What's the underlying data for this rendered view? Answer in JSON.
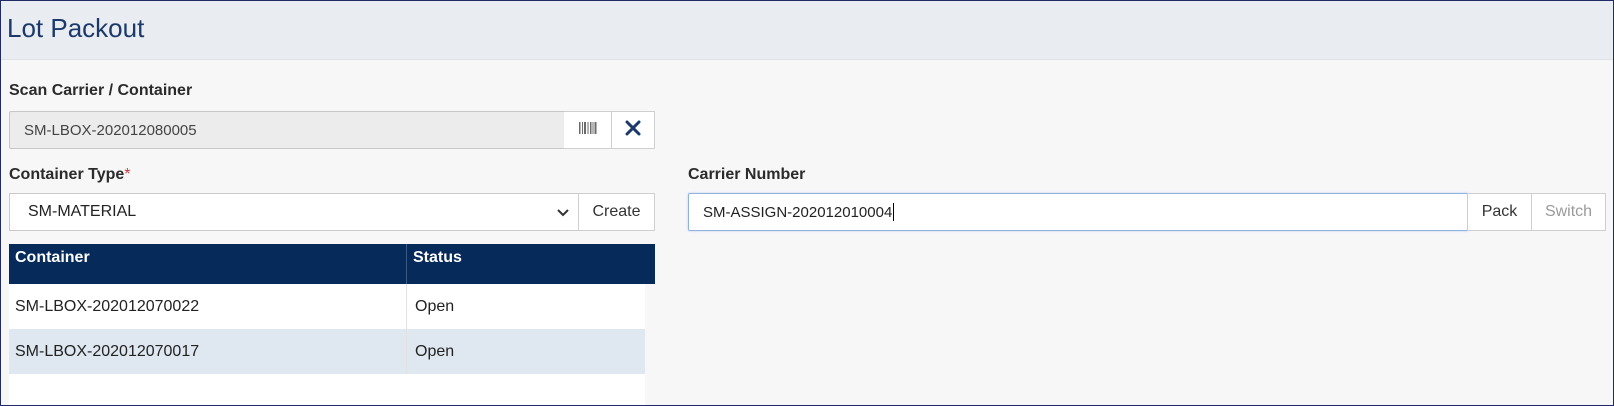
{
  "page": {
    "title": "Lot Packout"
  },
  "scan": {
    "label": "Scan Carrier / Container",
    "value": "SM-LBOX-202012080005",
    "barcode_icon": "barcode-icon",
    "clear_icon": "close-icon"
  },
  "container_type": {
    "label": "Container Type",
    "required_mark": "*",
    "selected": "SM-MATERIAL",
    "create_label": "Create"
  },
  "carrier": {
    "label": "Carrier Number",
    "value": "SM-ASSIGN-202012010004",
    "pack_label": "Pack",
    "switch_label": "Switch"
  },
  "table": {
    "columns": [
      "Container",
      "Status"
    ],
    "rows": [
      {
        "container": "SM-LBOX-202012070022",
        "status": "Open"
      },
      {
        "container": "SM-LBOX-202012070017",
        "status": "Open"
      }
    ]
  },
  "colors": {
    "header_bg": "#e9ecf1",
    "title": "#1b3a6b",
    "table_header_bg": "#062a5a",
    "selected_row_bg": "#dfe7f1",
    "required": "#d23a3a"
  }
}
